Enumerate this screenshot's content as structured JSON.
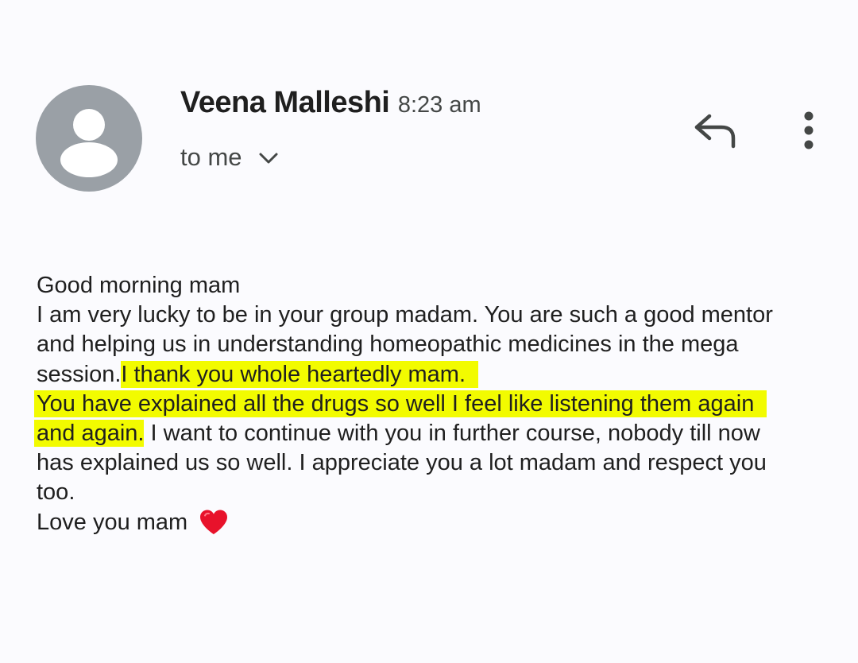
{
  "email": {
    "sender_name": "Veena Malleshi",
    "time": "8:23 am",
    "recipient": "to me",
    "icons": {
      "avatar": "person-avatar-icon",
      "details_toggle": "chevron-down-icon",
      "reply": "reply-icon",
      "more": "more-vertical-icon",
      "heart": "red-heart-emoji"
    },
    "colors": {
      "avatar_bg": "#9aa0a6",
      "highlight": "#f2fb00",
      "heart": "#e8122b"
    },
    "body": {
      "line1": "Good morning mam",
      "line2": "I am very lucky to be in your group madam. You are such a good mentor",
      "line3": "and helping us in understanding homeopathic medicines in the mega",
      "line4_plain": "session.",
      "line4_highlight": "I thank you whole heartedly mam.",
      "line5_highlight": "You have explained all the drugs so well I feel like listening them again",
      "line6_highlight": "and again.",
      "line6_plain": " I want to continue with you in further course, nobody till now",
      "line7": "has explained us so well. I appreciate you a lot madam and respect you",
      "line8": "too.",
      "line9": "Love you mam"
    }
  }
}
